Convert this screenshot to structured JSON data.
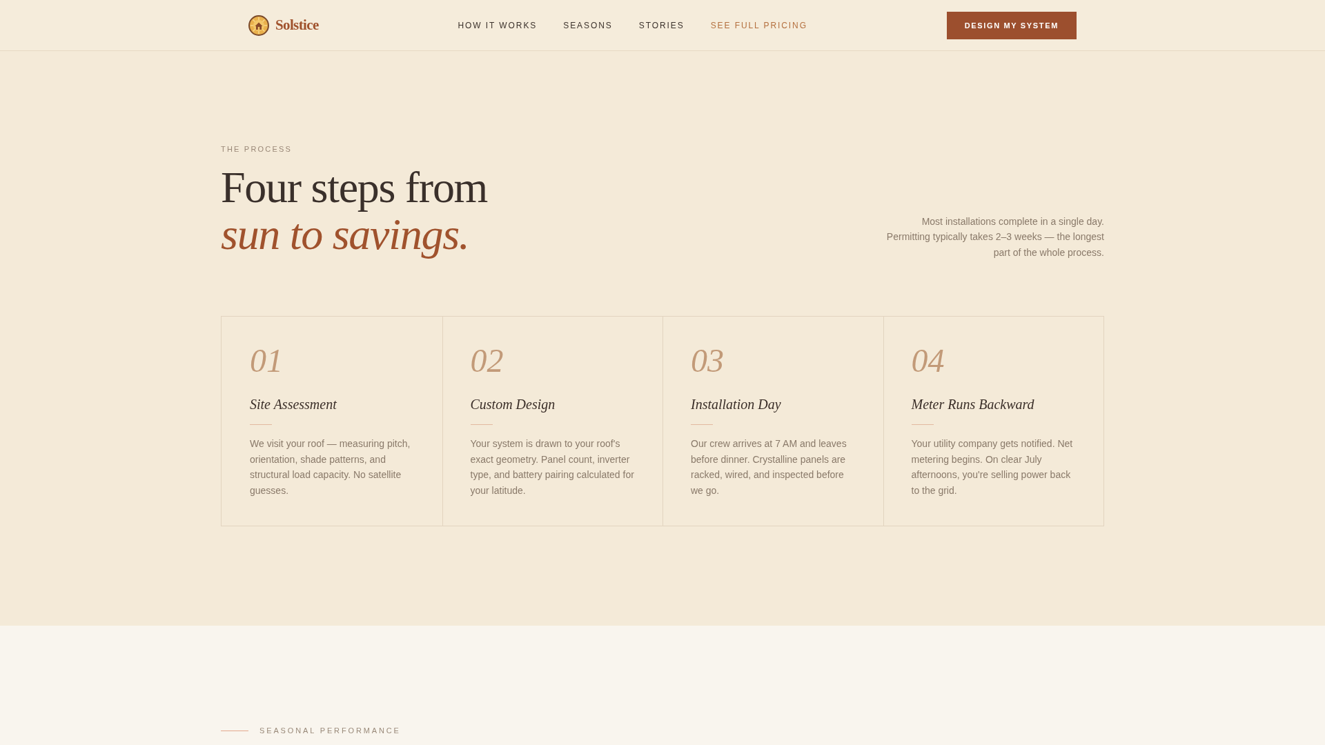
{
  "header": {
    "brand": "Solstice",
    "nav": [
      {
        "label": "HOW IT WORKS",
        "kind": "plain"
      },
      {
        "label": "SEASONS",
        "kind": "plain"
      },
      {
        "label": "STORIES",
        "kind": "plain"
      },
      {
        "label": "SEE FULL PRICING",
        "kind": "accent"
      }
    ],
    "cta": "DESIGN MY SYSTEM"
  },
  "process": {
    "eyebrow": "THE PROCESS",
    "title": "Four steps from *sun to savings.*",
    "note": "Most installations complete in a single day. Permitting typically takes 2–3 weeks — the longest part of the whole process.",
    "steps": [
      {
        "number": "01",
        "title": "Site Assessment",
        "text": "We visit your roof — measuring pitch, orientation, shade patterns, and structural load capacity. No satellite guesses."
      },
      {
        "number": "02",
        "title": "Custom Design",
        "text": "Your system is drawn to your roof's exact geometry. Panel count, inverter type, and battery pairing calculated for your latitude."
      },
      {
        "number": "03",
        "title": "Installation Day",
        "text": "Our crew arrives at 7 AM and leaves before dinner. Crystalline panels are racked, wired, and inspected before we go."
      },
      {
        "number": "04",
        "title": "Meter Runs Backward",
        "text": "Your utility company gets notified. Net metering begins. On clear July afternoons, you're selling power back to the grid."
      }
    ]
  },
  "seasonal": {
    "eyebrow": "SEASONAL PERFORMANCE"
  }
}
